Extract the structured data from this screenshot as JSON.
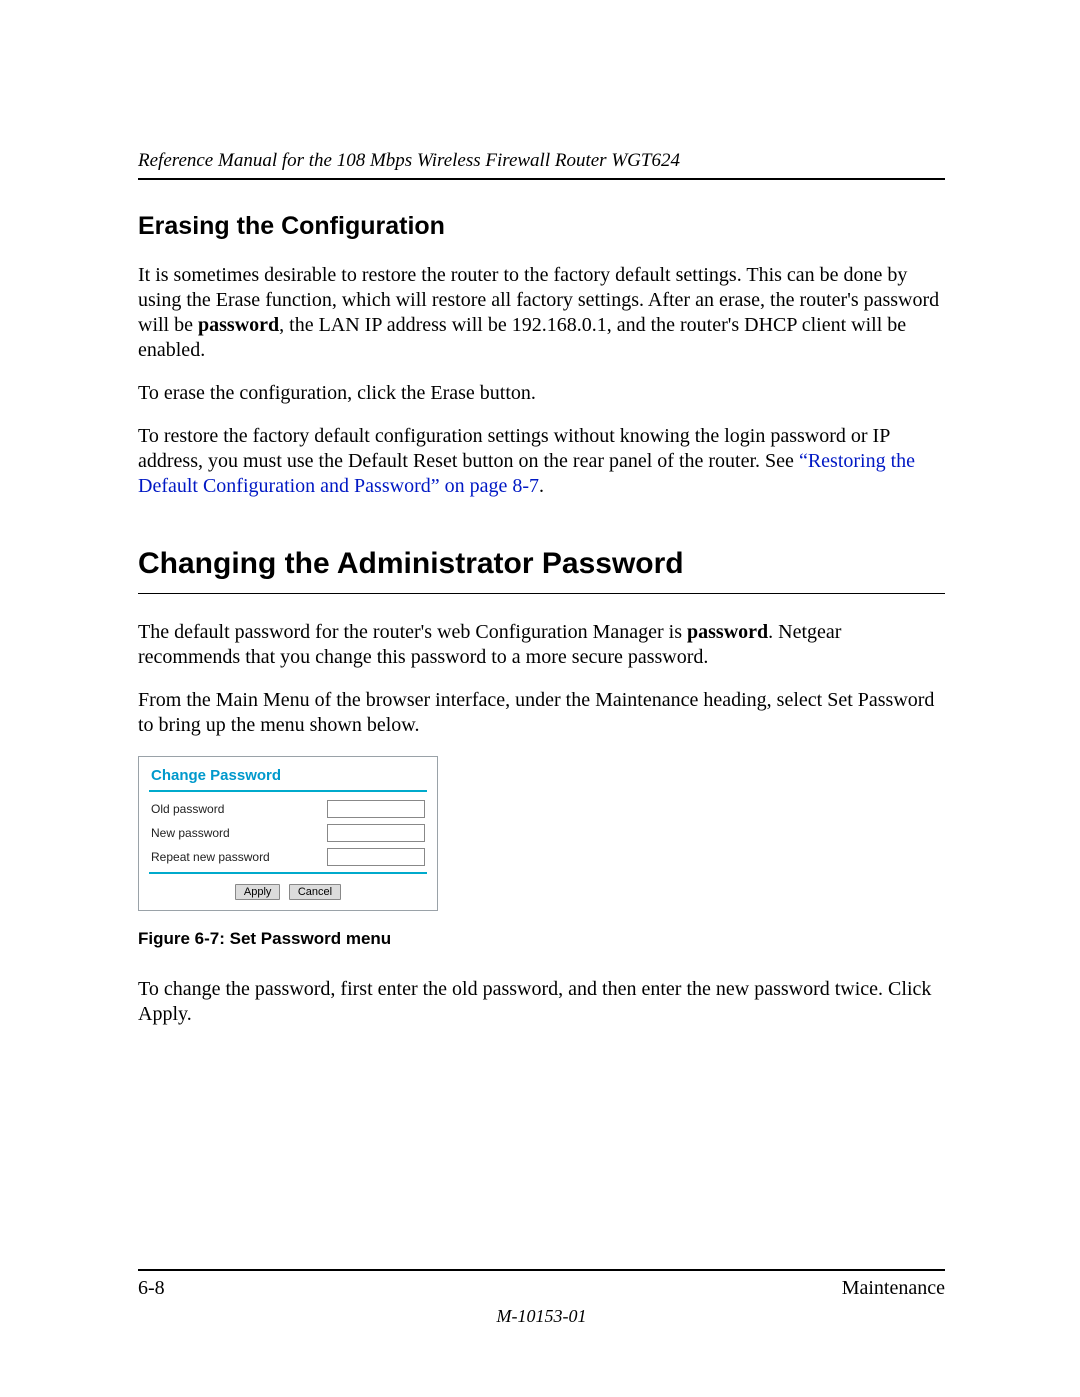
{
  "header": {
    "title": "Reference Manual for the 108 Mbps Wireless Firewall Router WGT624"
  },
  "section1": {
    "heading": "Erasing the Configuration",
    "p1_a": "It is sometimes desirable to restore the router to the factory default settings. This can be done by using the Erase function, which will restore all factory settings. After an erase, the router's password will be ",
    "p1_bold": "password",
    "p1_b": ", the LAN IP address will be 192.168.0.1, and the router's DHCP client will be enabled.",
    "p2": "To erase the configuration, click the Erase button.",
    "p3_a": "To restore the factory default configuration settings without knowing the login password or IP address, you must use the Default Reset button on the rear panel of the router. See ",
    "p3_link": "“Restoring the Default Configuration and Password” on page 8-7",
    "p3_b": "."
  },
  "section2": {
    "heading": "Changing the Administrator Password",
    "p1_a": "The default password for the router's web Configuration Manager is ",
    "p1_bold": "password",
    "p1_b": ". Netgear recommends that you change this password to a more secure password.",
    "p2": "From the Main Menu of the browser interface, under the Maintenance heading, select Set Password to bring up the menu shown below."
  },
  "figure": {
    "title": "Change Password",
    "rows": {
      "old": "Old password",
      "new": "New password",
      "repeat": "Repeat new password"
    },
    "buttons": {
      "apply": "Apply",
      "cancel": "Cancel"
    },
    "caption": "Figure 6-7:  Set Password menu"
  },
  "section2b": {
    "p3": "To change the password, first enter the old password, and then enter the new password twice. Click Apply."
  },
  "footer": {
    "page": "6-8",
    "section": "Maintenance",
    "docnum": "M-10153-01"
  }
}
